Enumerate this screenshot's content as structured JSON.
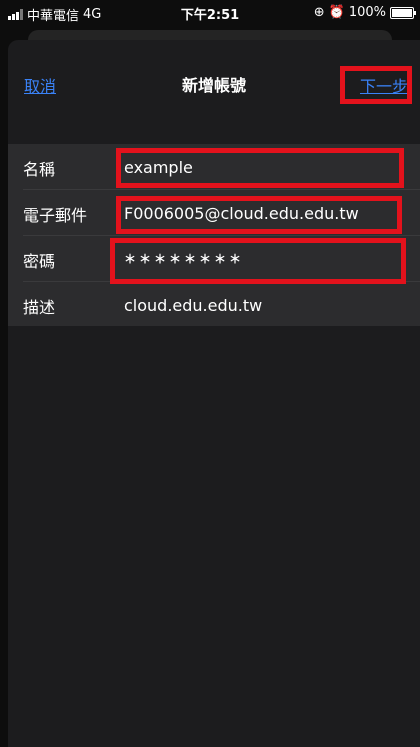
{
  "status_bar": {
    "carrier": "中華電信",
    "network": "4G",
    "time": "下午2:51",
    "battery": "100%",
    "battery_level": 1.0,
    "icons": [
      "signal-icon",
      "lock-rotation-icon",
      "alarm-icon",
      "battery-icon"
    ]
  },
  "nav": {
    "cancel_label": "取消",
    "title": "新增帳號",
    "next_label": "下一步"
  },
  "form": {
    "name_label": "名稱",
    "name_value": "example",
    "email_label": "電子郵件",
    "email_value": "F0006005@cloud.edu.edu.tw",
    "password_label": "密碼",
    "password_value": "＊＊＊＊＊＊＊＊",
    "description_label": "描述",
    "description_value": "cloud.edu.edu.tw"
  },
  "colors": {
    "link": "#3a82f7",
    "highlight": "#e3121c",
    "background": "#1c1c1e",
    "row_background": "#2c2c2e"
  }
}
